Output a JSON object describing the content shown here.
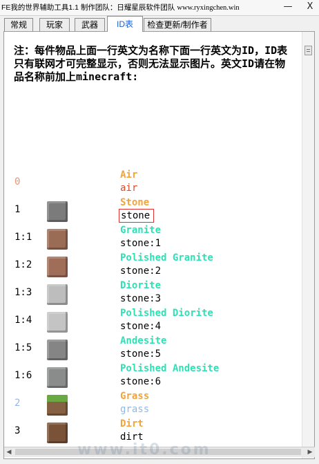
{
  "window": {
    "title_prefix": "FE我的世界辅助工具1.1 制作团队：日耀星辰软件团队 ",
    "title_url": "www.ryxingchen.win",
    "minimize_glyph": "—",
    "close_glyph": "X"
  },
  "tabs": [
    {
      "label": "常规"
    },
    {
      "label": "玩家"
    },
    {
      "label": "武器"
    },
    {
      "label": "ID表",
      "active": true
    },
    {
      "label": "检查更新/制作者"
    }
  ],
  "notice": "注：每件物品上面一行英文为名称下面一行英文为ID，ID表只有联网才可完整显示，否则无法显示图片。英文ID请在物品名称前加上minecraft:",
  "colors": {
    "name_default": "#f2a33a",
    "name_variant": "#2fe0b6",
    "code_default": "#000000",
    "code_air": "#e04a25",
    "code_grass": "#8fb8ea"
  },
  "items": [
    {
      "id": "0",
      "name": "Air",
      "code": "air",
      "block": "none",
      "id_color": "#e8956f",
      "name_color": "#f2a33a",
      "code_color": "#e04a25"
    },
    {
      "id": "1",
      "name": "Stone",
      "code": "stone",
      "block": "stone",
      "id_color": "#000000",
      "name_color": "#f2a33a",
      "code_color": "#000000",
      "boxed": true
    },
    {
      "id": "1:1",
      "name": "Granite",
      "code": "stone:1",
      "block": "granite",
      "id_color": "#000000",
      "name_color": "#2fe0b6",
      "code_color": "#000000"
    },
    {
      "id": "1:2",
      "name": "Polished Granite",
      "code": "stone:2",
      "block": "polished-granite",
      "id_color": "#000000",
      "name_color": "#2fe0b6",
      "code_color": "#000000"
    },
    {
      "id": "1:3",
      "name": "Diorite",
      "code": "stone:3",
      "block": "diorite",
      "id_color": "#000000",
      "name_color": "#2fe0b6",
      "code_color": "#000000"
    },
    {
      "id": "1:4",
      "name": "Polished Diorite",
      "code": "stone:4",
      "block": "polished-diorite",
      "id_color": "#000000",
      "name_color": "#2fe0b6",
      "code_color": "#000000"
    },
    {
      "id": "1:5",
      "name": "Andesite",
      "code": "stone:5",
      "block": "andesite",
      "id_color": "#000000",
      "name_color": "#2fe0b6",
      "code_color": "#000000"
    },
    {
      "id": "1:6",
      "name": "Polished Andesite",
      "code": "stone:6",
      "block": "polished-andesite",
      "id_color": "#000000",
      "name_color": "#2fe0b6",
      "code_color": "#000000"
    },
    {
      "id": "2",
      "name": "Grass",
      "code": "grass",
      "block": "grass",
      "id_color": "#8fb8ea",
      "name_color": "#f2a33a",
      "code_color": "#8fb8ea"
    },
    {
      "id": "3",
      "name": "Dirt",
      "code": "dirt",
      "block": "dirt",
      "id_color": "#000000",
      "name_color": "#f2a33a",
      "code_color": "#000000"
    }
  ],
  "block_colors": {
    "stone": "#7b7b7b",
    "granite": "#9a6b55",
    "polished-granite": "#a06d58",
    "diorite": "#bdbdbd",
    "polished-diorite": "#c4c4c4",
    "andesite": "#858585",
    "polished-andesite": "#8a8b8b",
    "grass": "#866043",
    "dirt": "#7a5238"
  },
  "watermark": "www.it0.com"
}
